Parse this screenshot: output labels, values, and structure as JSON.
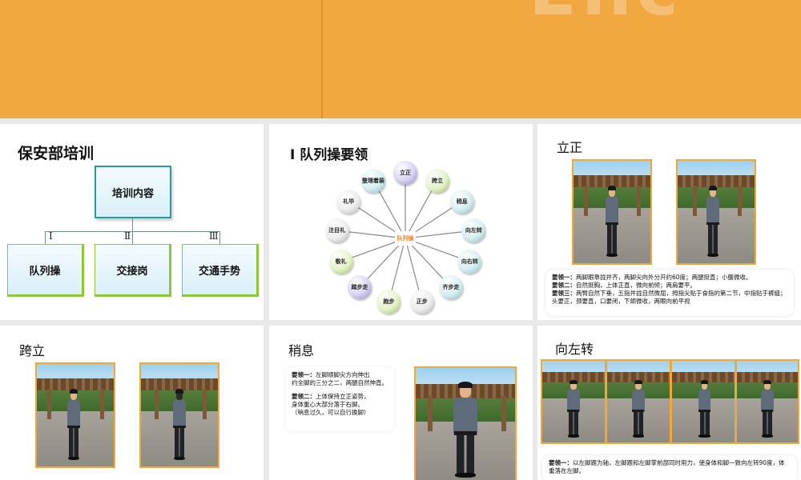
{
  "banner": {
    "decor_text": "Enc"
  },
  "slide1": {
    "title": "保安部培训",
    "root": "培训内容",
    "children": [
      {
        "roman": "Ⅰ",
        "label": "队列操"
      },
      {
        "roman": "Ⅱ",
        "label": "交接岗"
      },
      {
        "roman": "Ⅲ",
        "label": "交通手势"
      }
    ]
  },
  "slide2": {
    "title": "Ⅰ 队列操要领",
    "hub": "队列操",
    "nodes": [
      "立正",
      "跨立",
      "稍息",
      "向左转",
      "向右转",
      "齐步走",
      "正步",
      "跑步",
      "踏步走",
      "敬礼",
      "注目礼",
      "礼毕",
      "整理着装"
    ]
  },
  "slide3": {
    "title": "立正",
    "notes": [
      {
        "key": "要领一：",
        "text": "两脚跟靠拢并齐，两脚尖向外分开约60度；两腿挺直；小腹微收。"
      },
      {
        "key": "要领二：",
        "text": "自然挺胸，上体正直，微向前倾；两肩要平。"
      },
      {
        "key": "要领三：",
        "text": "两臂自然下垂，五指并拢自然微屈，拇指尖贴于食指的第二节，中指贴于裤缝；头要正，颈要直，口要闭，下颌微收，两眼向前平视"
      }
    ]
  },
  "slide4": {
    "title": "跨立"
  },
  "slide5": {
    "title": "稍息",
    "note1_key": "要领一：",
    "note1_text_a": "左脚顺脚尖方向伸出",
    "note1_text_b": "约全脚的三分之二，两腿自然伸直。",
    "note2_key": "要领二：",
    "note2_text_a": "上体保持立正姿势，",
    "note2_text_b": "身体重心大部分落于右脚。",
    "note2_text_c": "（稍息过久，可以自行换脚）"
  },
  "slide6": {
    "title": "向左转",
    "note_key": "要领一：",
    "note_text": "以左脚跟为轴，左脚跟和左脚掌前部同时用力，使身体和脚一致向左转90度，体重落在左脚。"
  },
  "colors": {
    "banner": "#f2a840",
    "photo_border": "#f0a838",
    "box_border": "#2a9aa0",
    "child_border": "#8cc63f",
    "hub_text": "#e8822a"
  }
}
